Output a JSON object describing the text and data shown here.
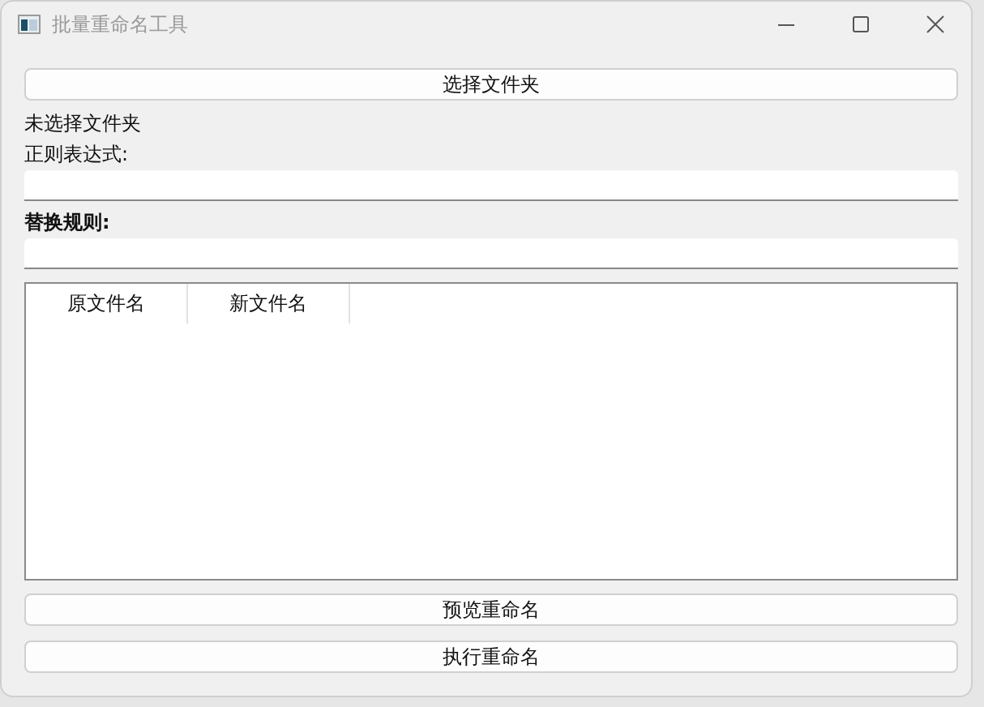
{
  "window": {
    "title": "批量重命名工具"
  },
  "select_button": {
    "label": "选择文件夹"
  },
  "folder_status": "未选择文件夹",
  "regex": {
    "label": "正则表达式:"
  },
  "replace": {
    "label": "替换规则:"
  },
  "table": {
    "columns": [
      "原文件名",
      "新文件名"
    ]
  },
  "buttons": [
    {
      "label": "预览重命名"
    },
    {
      "label": "执行重命名"
    }
  ]
}
